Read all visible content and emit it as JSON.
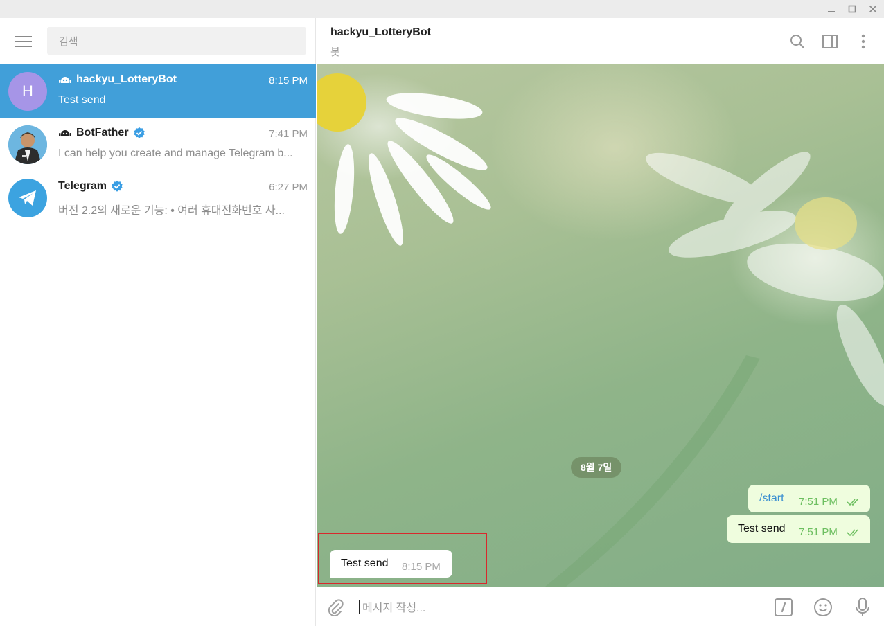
{
  "window": {
    "controls": [
      "minimize-icon",
      "maximize-icon",
      "close-icon"
    ]
  },
  "sidebar": {
    "search_placeholder": "검색",
    "chats": [
      {
        "name": "hackyu_LotteryBot",
        "time": "8:15 PM",
        "preview": "Test send",
        "avatar_letter": "H",
        "avatar_color": "#a695e7",
        "is_bot": true,
        "verified": false,
        "active": true
      },
      {
        "name": "BotFather",
        "time": "7:41 PM",
        "preview": "I can help you create and manage Telegram b...",
        "is_bot": true,
        "verified": true,
        "active": false
      },
      {
        "name": "Telegram",
        "time": "6:27 PM",
        "preview": "버전 2.2의 새로운 기능: • 여러 휴대전화번호 사...",
        "verified": true,
        "active": false
      }
    ]
  },
  "header": {
    "title": "hackyu_LotteryBot",
    "subtitle": "봇"
  },
  "conversation": {
    "date_label": "8월 7일",
    "messages": [
      {
        "direction": "out",
        "text": "/start",
        "time": "7:51 PM",
        "status": "read"
      },
      {
        "direction": "out",
        "text": "Test send",
        "time": "7:51 PM",
        "status": "read"
      },
      {
        "direction": "in",
        "text": "Test send",
        "time": "8:15 PM"
      }
    ]
  },
  "composer": {
    "placeholder": "메시지 작성..."
  },
  "colors": {
    "accent": "#419fd9",
    "outgoing_bubble": "#effdde",
    "read_check": "#6dbf60",
    "highlight_box": "#d8282c"
  }
}
